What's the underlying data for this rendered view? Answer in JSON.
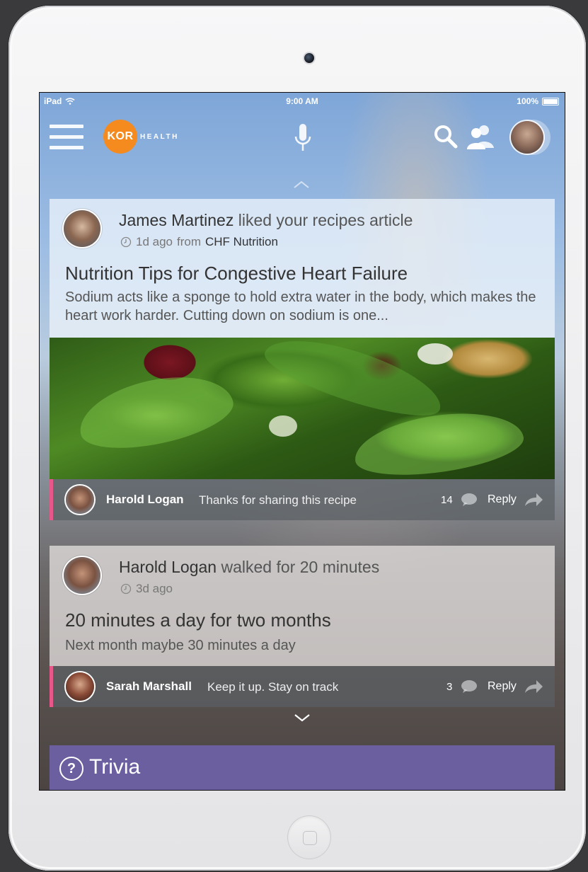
{
  "status_bar": {
    "device": "iPad",
    "time": "9:00 AM",
    "battery": "100%"
  },
  "header": {
    "logo_mark": "KOR",
    "logo_text": "HEALTH"
  },
  "feed": [
    {
      "actor": "James Martinez",
      "action": "liked your recipes article",
      "time_ago": "1d ago",
      "from_label": "from",
      "source": "CHF Nutrition",
      "title": "Nutrition Tips for Congestive Heart Failure",
      "excerpt": "Sodium acts like a sponge to hold extra water in the body, which makes the heart work harder. Cutting down on sodium is one...",
      "comment": {
        "name": "Harold Logan",
        "text": "Thanks for sharing this recipe",
        "count": "14",
        "reply": "Reply"
      }
    },
    {
      "actor": "Harold Logan",
      "action": "walked for 20 minutes",
      "time_ago": "3d ago",
      "title": "20 minutes a day for two months",
      "excerpt": "Next month maybe 30 minutes a day",
      "comment": {
        "name": "Sarah Marshall",
        "text": "Keep it up. Stay on track",
        "count": "3",
        "reply": "Reply"
      }
    }
  ],
  "trivia": {
    "icon": "?",
    "label": "Trivia"
  },
  "colors": {
    "accent_orange": "#f58a1f",
    "comment_marker": "#e8578a",
    "trivia_purple": "#6b5fa0"
  },
  "icons": [
    "menu-icon",
    "microphone-icon",
    "search-icon",
    "people-icon",
    "clock-icon",
    "comment-bubble-icon",
    "share-arrow-icon",
    "chevron-up-icon",
    "chevron-down-icon",
    "question-icon"
  ]
}
